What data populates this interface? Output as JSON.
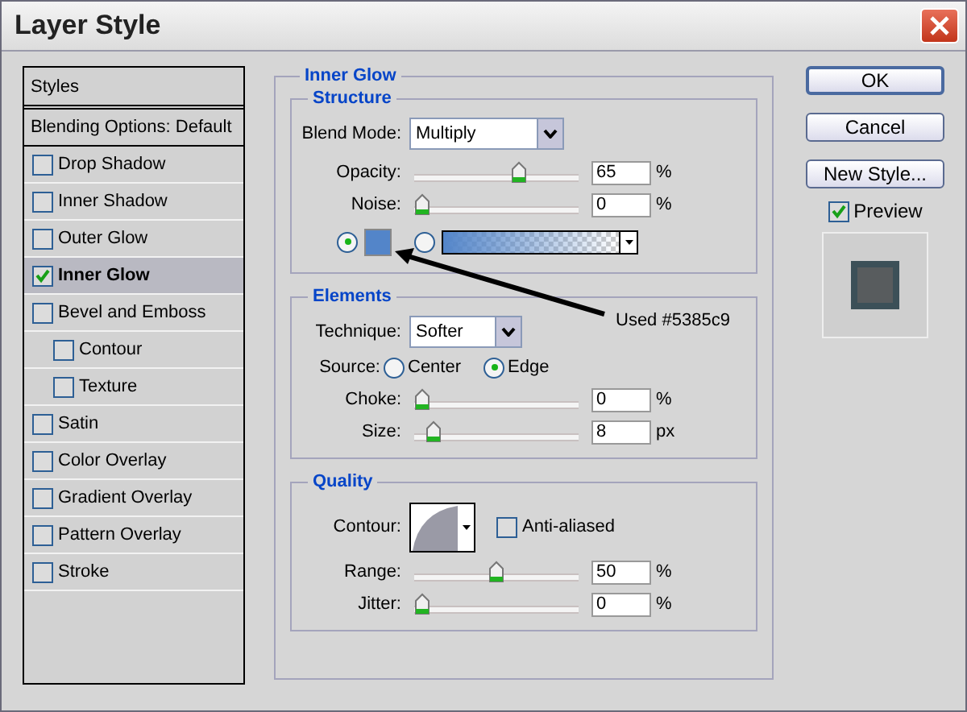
{
  "window": {
    "title": "Layer Style"
  },
  "styles_list": {
    "header": "Styles",
    "items": [
      {
        "label": "Blending Options: Default",
        "kind": "plain",
        "selected": false
      },
      {
        "label": "Drop Shadow",
        "kind": "check",
        "checked": false,
        "selected": false
      },
      {
        "label": "Inner Shadow",
        "kind": "check",
        "checked": false,
        "selected": false
      },
      {
        "label": "Outer Glow",
        "kind": "check",
        "checked": false,
        "selected": false
      },
      {
        "label": "Inner Glow",
        "kind": "check",
        "checked": true,
        "selected": true
      },
      {
        "label": "Bevel and Emboss",
        "kind": "check",
        "checked": false,
        "selected": false,
        "children": [
          {
            "label": "Contour",
            "kind": "check",
            "checked": false,
            "selected": false
          },
          {
            "label": "Texture",
            "kind": "check",
            "checked": false,
            "selected": false
          }
        ]
      },
      {
        "label": "Satin",
        "kind": "check",
        "checked": false,
        "selected": false
      },
      {
        "label": "Color Overlay",
        "kind": "check",
        "checked": false,
        "selected": false
      },
      {
        "label": "Gradient Overlay",
        "kind": "check",
        "checked": false,
        "selected": false
      },
      {
        "label": "Pattern Overlay",
        "kind": "check",
        "checked": false,
        "selected": false
      },
      {
        "label": "Stroke",
        "kind": "check",
        "checked": false,
        "selected": false
      }
    ]
  },
  "panel": {
    "title": "Inner Glow",
    "structure": {
      "title": "Structure",
      "blend_mode": {
        "label": "Blend Mode:",
        "value": "Multiply"
      },
      "sliders": [
        {
          "label": "Opacity:",
          "level": 0.65,
          "value": "65",
          "unit": "%"
        },
        {
          "label": "Noise:",
          "level": 0,
          "value": "0",
          "unit": "%"
        }
      ],
      "fill": [
        {
          "kind": "color",
          "selected": true,
          "color": "#5385c9"
        },
        {
          "kind": "gradient",
          "selected": false,
          "color": "#5385c9"
        }
      ]
    },
    "elements": {
      "title": "Elements",
      "technique": {
        "label": "Technique:",
        "value": "Softer"
      },
      "source": {
        "label": "Source:",
        "options": [
          {
            "label": "Center",
            "selected": false
          },
          {
            "label": "Edge",
            "selected": true
          }
        ]
      },
      "sliders": [
        {
          "label": "Choke:",
          "level": 0,
          "value": "0",
          "unit": "%"
        },
        {
          "label": "Size:",
          "level": 0.08,
          "value": "8",
          "unit": "px"
        }
      ]
    },
    "quality": {
      "title": "Quality",
      "contour": {
        "label": "Contour:"
      },
      "anti_aliased": {
        "label": "Anti-aliased",
        "checked": false
      },
      "sliders": [
        {
          "label": "Range:",
          "level": 0.5,
          "value": "50",
          "unit": "%"
        },
        {
          "label": "Jitter:",
          "level": 0,
          "value": "0",
          "unit": "%"
        }
      ]
    }
  },
  "annotation": {
    "text": "Used #5385c9"
  },
  "buttons": [
    {
      "label": "OK",
      "kind": "default"
    },
    {
      "label": "Cancel",
      "kind": "normal"
    },
    {
      "label": "New Style...",
      "kind": "normal"
    }
  ],
  "preview": {
    "label": "Preview",
    "checked": true
  }
}
